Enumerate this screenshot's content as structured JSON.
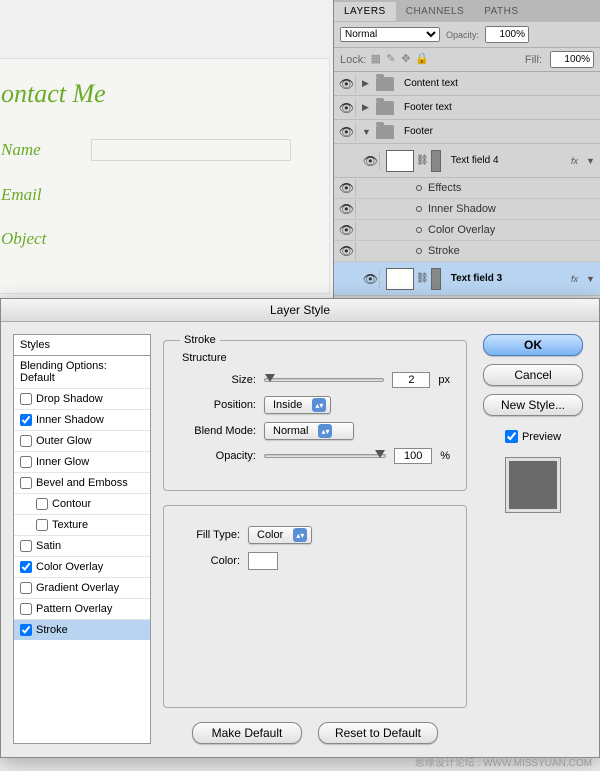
{
  "bg_form": {
    "title": "ontact Me",
    "labels": [
      "Name",
      "Email",
      "Object"
    ]
  },
  "layers_panel": {
    "tabs": [
      "LAYERS",
      "CHANNELS",
      "PATHS"
    ],
    "blend_mode": "Normal",
    "opacity_label": "Opacity:",
    "opacity_value": "100%",
    "lock_label": "Lock:",
    "fill_label": "Fill:",
    "fill_value": "100%",
    "items": [
      {
        "name": "Content text",
        "type": "group",
        "expanded": false
      },
      {
        "name": "Footer text",
        "type": "group",
        "expanded": false
      },
      {
        "name": "Footer",
        "type": "group",
        "expanded": true
      }
    ],
    "text_field_4": "Text field 4",
    "text_field_3": "Text field 3",
    "fx_label": "fx",
    "effects_label": "Effects",
    "effects": [
      "Inner Shadow",
      "Color Overlay",
      "Stroke"
    ]
  },
  "dialog": {
    "title": "Layer Style",
    "styles_header": "Styles",
    "styles": [
      {
        "label": "Blending Options: Default",
        "checked": null,
        "first": true
      },
      {
        "label": "Drop Shadow",
        "checked": false
      },
      {
        "label": "Inner Shadow",
        "checked": true
      },
      {
        "label": "Outer Glow",
        "checked": false
      },
      {
        "label": "Inner Glow",
        "checked": false
      },
      {
        "label": "Bevel and Emboss",
        "checked": false
      },
      {
        "label": "Contour",
        "checked": false,
        "indent": true
      },
      {
        "label": "Texture",
        "checked": false,
        "indent": true
      },
      {
        "label": "Satin",
        "checked": false
      },
      {
        "label": "Color Overlay",
        "checked": true
      },
      {
        "label": "Gradient Overlay",
        "checked": false
      },
      {
        "label": "Pattern Overlay",
        "checked": false
      },
      {
        "label": "Stroke",
        "checked": true,
        "active": true
      }
    ],
    "group_titles": {
      "stroke": "Stroke",
      "structure": "Structure"
    },
    "fields": {
      "size_label": "Size:",
      "size_value": "2",
      "size_unit": "px",
      "position_label": "Position:",
      "position_value": "Inside",
      "blend_label": "Blend Mode:",
      "blend_value": "Normal",
      "opacity_label": "Opacity:",
      "opacity_value": "100",
      "opacity_unit": "%",
      "fill_type_label": "Fill Type:",
      "fill_type_value": "Color",
      "color_label": "Color:"
    },
    "buttons": {
      "make_default": "Make Default",
      "reset_default": "Reset to Default",
      "ok": "OK",
      "cancel": "Cancel",
      "new_style": "New Style...",
      "preview": "Preview"
    }
  },
  "watermark": "思缘设计论坛 . WWW.MISSYUAN.COM"
}
